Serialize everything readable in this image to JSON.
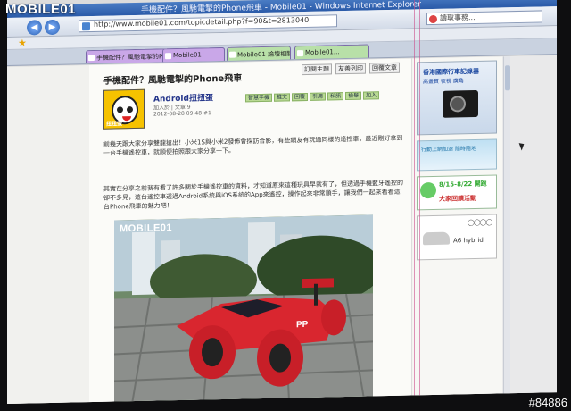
{
  "watermark": {
    "logo": "MOBILE01",
    "id": "#84886"
  },
  "browser": {
    "window_title": "手機配件？風馳電掣的Phone飛車 - Mobile01 - Windows Internet Explorer",
    "address": "http://www.mobile01.com/topicdetail.php?f=90&t=2813040",
    "search_placeholder": "讀取事務..."
  },
  "tabs": [
    {
      "label": "手機配件？風馳電掣的Phone飛...",
      "color": "#c9a7e8"
    },
    {
      "label": "Mobile01",
      "color": "#c9a7e8"
    },
    {
      "label": "Mobile01 論壇相關新聞...",
      "color": "#b8e0a8"
    },
    {
      "label": "Mobile01...",
      "color": "#b8e0a8"
    }
  ],
  "article": {
    "title": "手機配件？風馳電掣的Phone飛車",
    "buttons": [
      "訂閱主題",
      "友善列印",
      "回覆文章"
    ],
    "author": {
      "name": "Android扭扭蛋",
      "avatar_caption": "扭扭蛋",
      "stats": "加入於 | 文章 9",
      "date": "2012-08-28 09:48 #1"
    },
    "tags": [
      "智慧手機",
      "推文",
      "回覆",
      "引用",
      "私訊",
      "檢舉",
      "加入",
      "分享",
      "列印",
      "分享"
    ],
    "paragraph1": "前幾天跟大家分享雙龍搶出！小米1S與小米2發佈會採訪合影，有些網友有玩過同樣的遙控車，最近剛好拿到一台手機遙控車，就順便拍照跟大家分享一下。",
    "paragraph1_link": "雙龍搶出！小米1S與小米2發佈會採訪合影",
    "paragraph2": "其實在分享之前我有看了許多關於手機遙控車的資料，才知道原來這種玩具早就有了，但透過手機藍牙遙控的卻不多見，這台遙控車透過Android系統與iOS系統的App來遙控，操作起來非常順手，讓我們一起來看看這台Phone飛車的魅力吧！",
    "photo_logo": "MOBILE01"
  },
  "sidebar": {
    "ad_camera": {
      "title": "香港國際行車記錄器",
      "subtitle": "高畫質 夜視 廣角"
    },
    "ad_banner": {
      "text": "行動上網加速 隨時隨地"
    },
    "ad_green": {
      "title": "8/15-8/22 開跑",
      "subtitle": "大家回饋活動"
    },
    "ad_audi": {
      "rings": "◯◯◯◯",
      "text": "A6 hybrid"
    }
  }
}
